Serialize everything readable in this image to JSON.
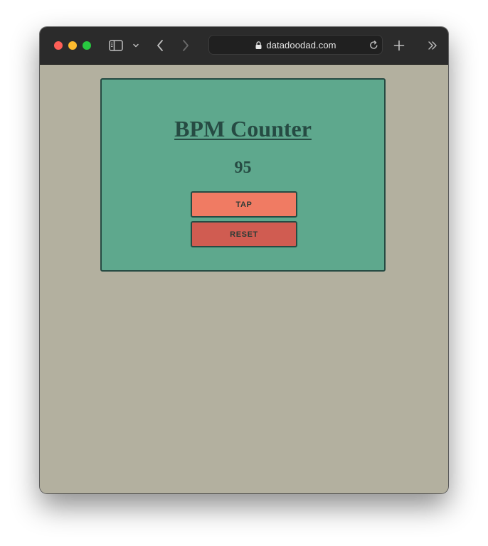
{
  "browser": {
    "url": "datadoodad.com",
    "icons": {
      "close": "close-traffic-light",
      "minimize": "minimize-traffic-light",
      "maximize": "maximize-traffic-light",
      "sidebar": "sidebar-icon",
      "sidebar_menu": "chevron-down-icon",
      "back": "chevron-left-icon",
      "forward": "chevron-right-icon",
      "lock": "lock-icon",
      "reload": "reload-icon",
      "new_tab": "plus-icon",
      "more": "double-chevron-right-icon"
    },
    "colors": {
      "toolbar": "#2b2b2b",
      "close": "#fe5f57",
      "minimize": "#febc2e",
      "maximize": "#28c840"
    }
  },
  "app": {
    "title": "BPM Counter",
    "bpm": "95",
    "tap_label": "TAP",
    "reset_label": "RESET",
    "colors": {
      "page_background": "#b3b09f",
      "card_background": "#5ea88d",
      "border_and_text": "#264b43",
      "tap_button": "#f07b63",
      "reset_button": "#d05c51"
    }
  }
}
